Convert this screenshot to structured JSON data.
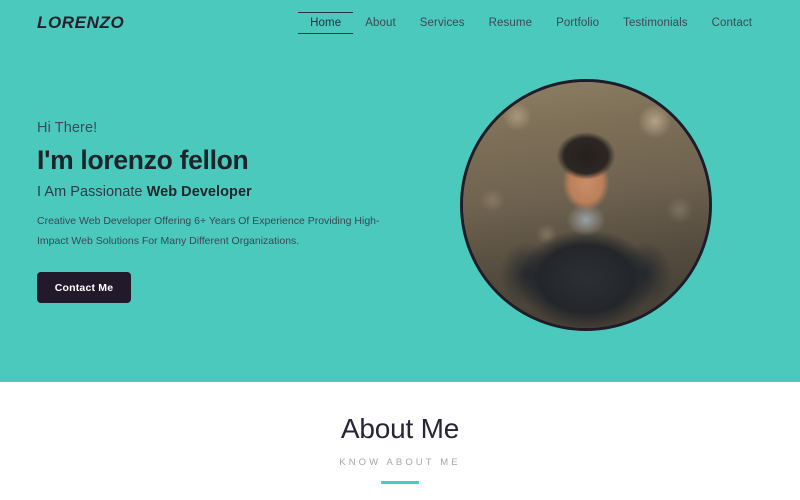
{
  "brand": {
    "logo": "LORENZO"
  },
  "nav": {
    "items": [
      {
        "label": "Home",
        "active": true
      },
      {
        "label": "About",
        "active": false
      },
      {
        "label": "Services",
        "active": false
      },
      {
        "label": "Resume",
        "active": false
      },
      {
        "label": "Portfolio",
        "active": false
      },
      {
        "label": "Testimonials",
        "active": false
      },
      {
        "label": "Contact",
        "active": false
      }
    ]
  },
  "hero": {
    "greeting": "Hi There!",
    "headline": "I'm lorenzo fellon",
    "subhead_prefix": "I Am Passionate ",
    "subhead_strong": "Web Developer",
    "description": "Creative Web Developer Offering 6+ Years Of Experience Providing High-Impact Web Solutions For Many Different Organizations.",
    "cta_label": "Contact Me",
    "portrait_alt": "portrait-photo-of-smiling-man-in-black-jacket-outdoors",
    "background_color": "#4cc9bd",
    "cta_color": "#221a2a"
  },
  "about": {
    "title": "About Me",
    "subtitle": "KNOW ABOUT ME",
    "accent_color": "#4cc9bd"
  }
}
